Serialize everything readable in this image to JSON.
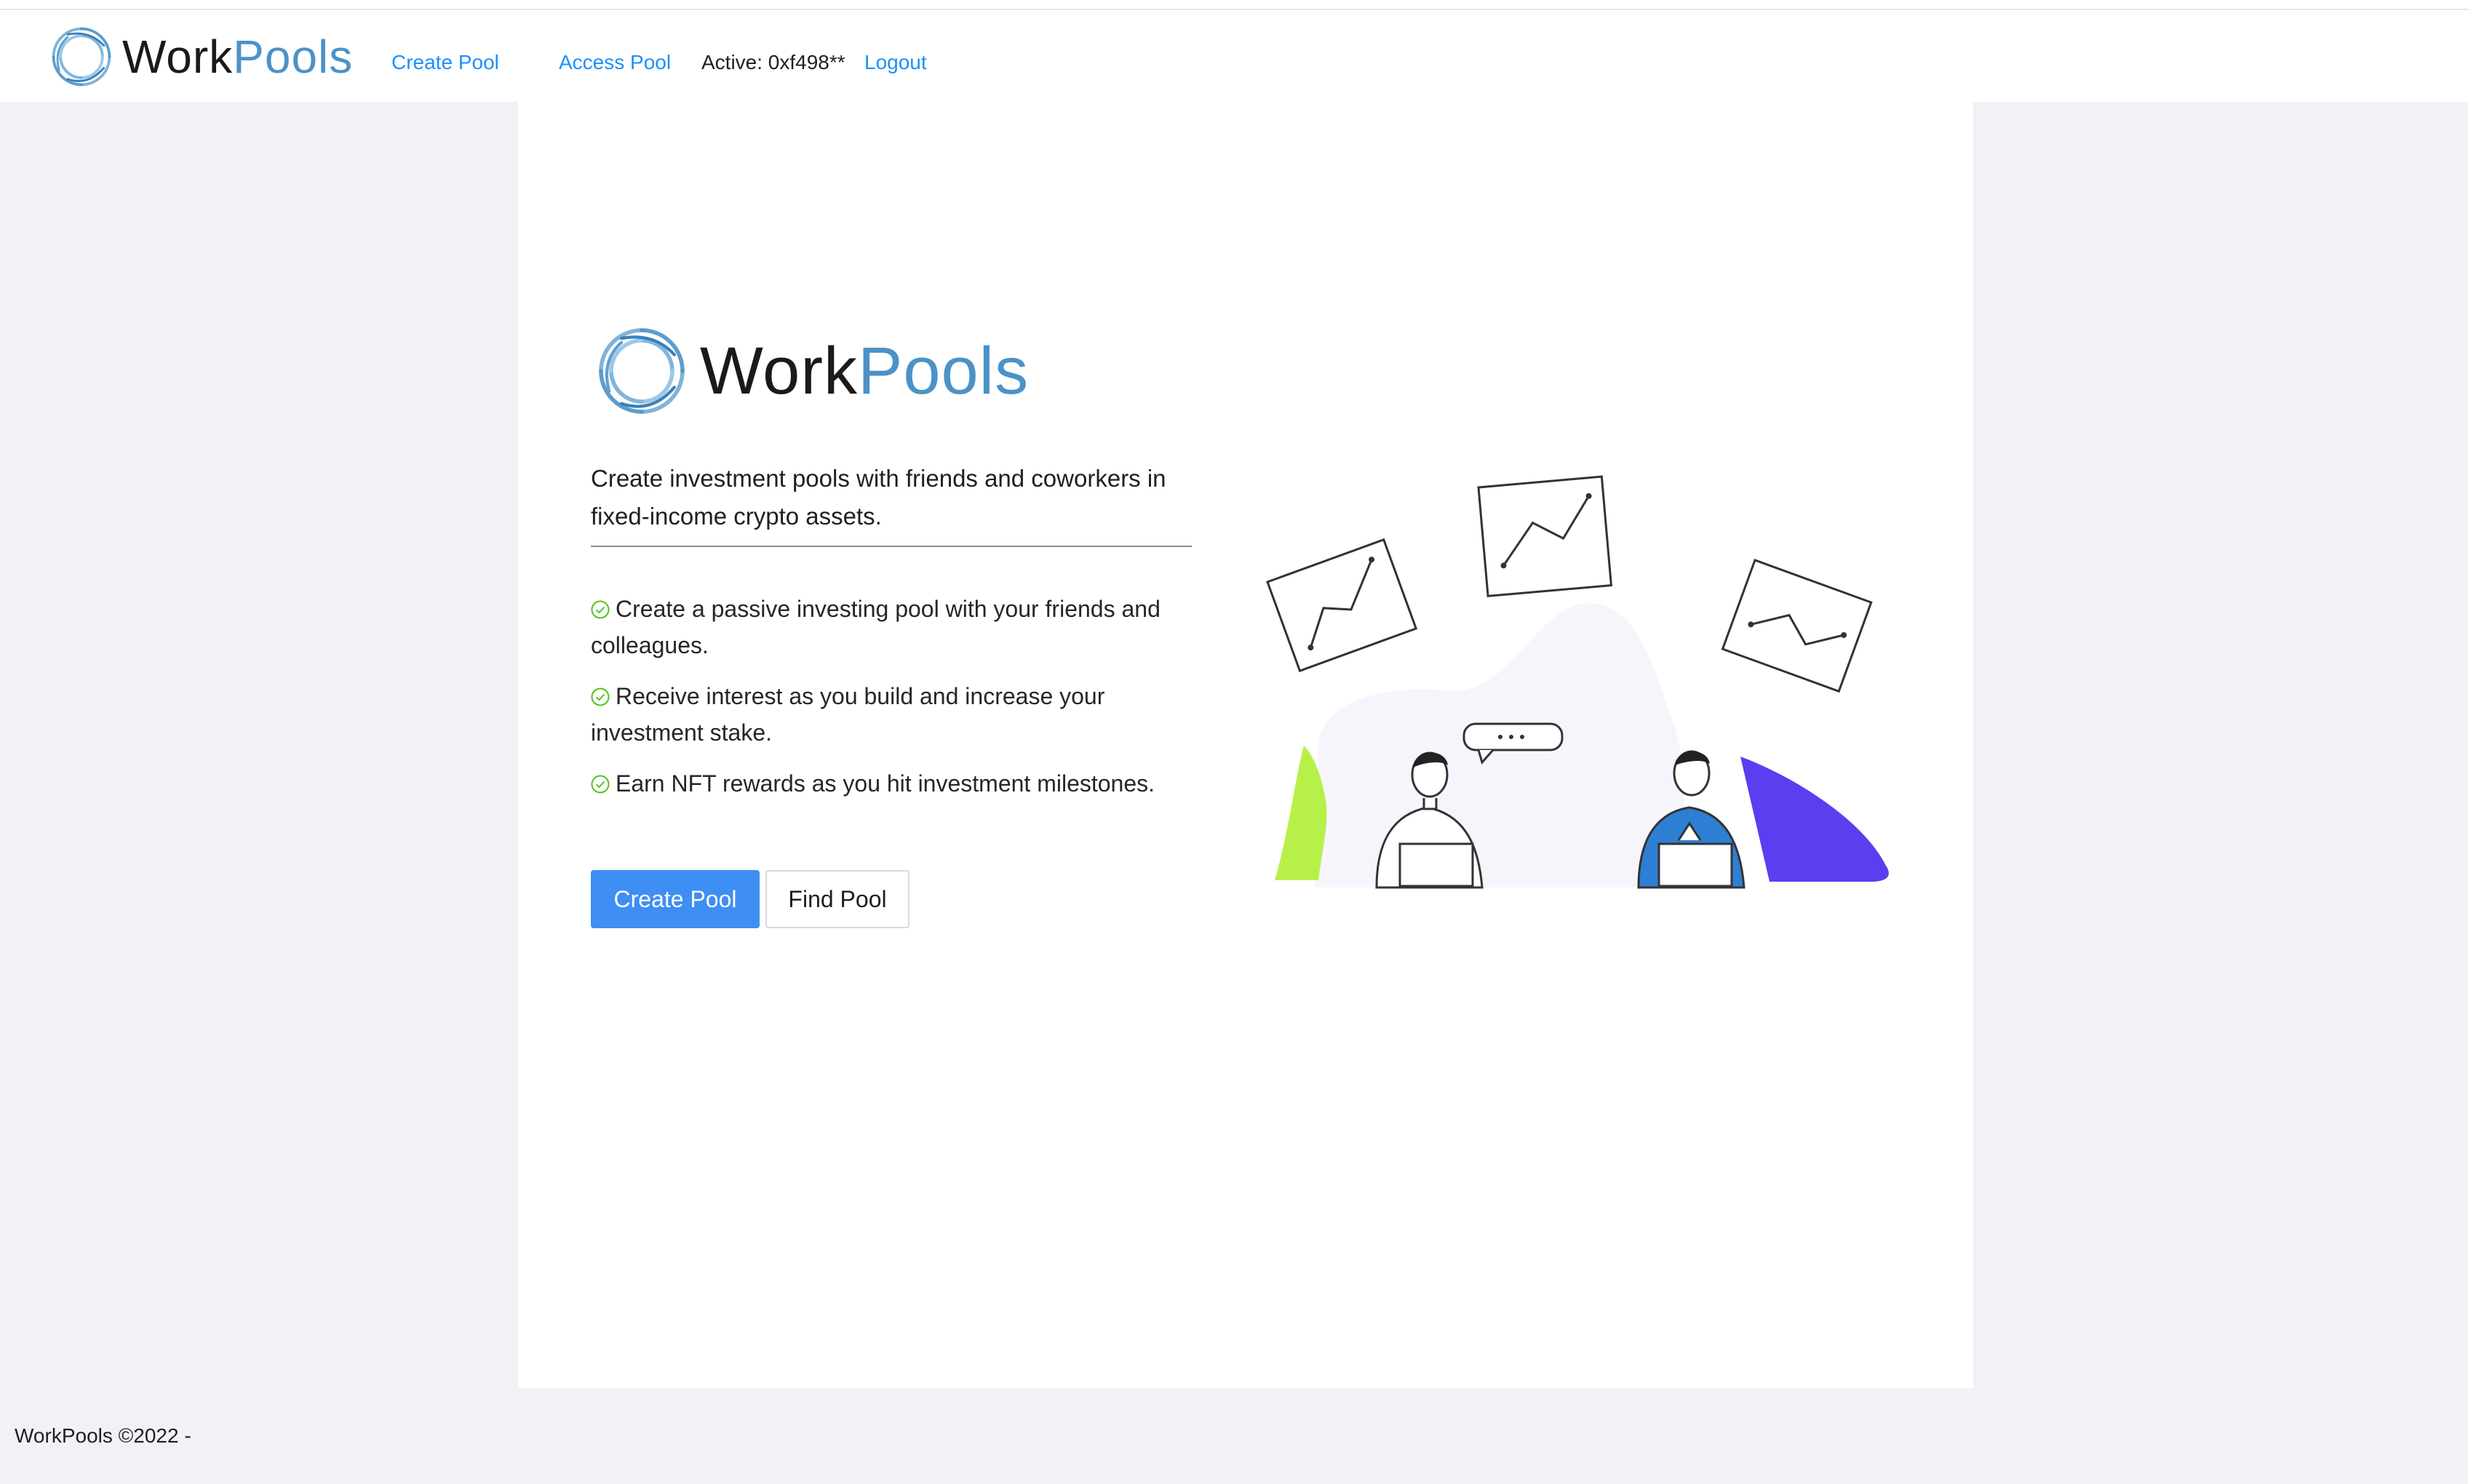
{
  "header": {
    "brand_part1": "Work",
    "brand_part2": "Pools",
    "nav": [
      "Create Pool",
      "Access Pool"
    ],
    "active_account": "Active: 0xf498**",
    "logout_label": "Logout"
  },
  "hero": {
    "brand_part1": "Work",
    "brand_part2": "Pools",
    "tagline": "Create investment pools with friends and coworkers in fixed-income crypto assets.",
    "features": [
      "Create a passive investing pool with your friends and colleagues.",
      "Receive interest as you build and increase your investment stake.",
      "Earn NFT rewards as you hit investment milestones."
    ],
    "feature_icon": "check-circle-icon",
    "primary_button": "Create Pool",
    "secondary_button": "Find Pool"
  },
  "footer": {
    "text": "WorkPools ©2022 -"
  },
  "colors": {
    "accent": "#1890ff",
    "primary_button": "#3f8ef3",
    "brand_blue": "#4b92c8",
    "check_green": "#52c41a",
    "page_bg": "#f0f2f5",
    "illustration_green": "#b8f04a",
    "illustration_purple": "#5a3ef0",
    "illustration_person_blue": "#2d7fd3"
  }
}
